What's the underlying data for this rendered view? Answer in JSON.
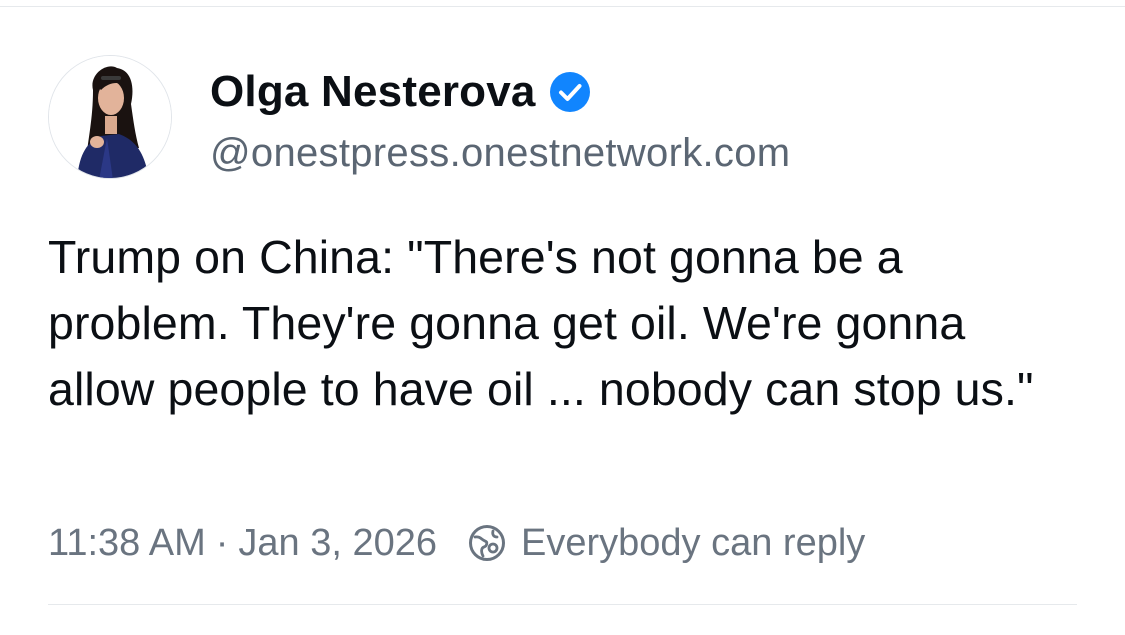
{
  "post": {
    "author": {
      "display_name": "Olga Nesterova",
      "handle": "@onestpress.onestnetwork.com",
      "verified_icon": "verified-check-icon",
      "avatar": "avatar-photo"
    },
    "text": "Trump on China: \"There's not gonna be a problem. They're gonna get oil. We're gonna allow people to have oil ... nobody can stop us.\"",
    "time": "11:38 AM",
    "separator": "·",
    "date": "Jan 3, 2026",
    "reply_setting": {
      "icon": "globe-icon",
      "label": "Everybody can reply"
    }
  },
  "colors": {
    "text": "#0b0f14",
    "secondary": "#6a7480",
    "verified": "#1185fe",
    "divider": "#e6e9ec"
  }
}
